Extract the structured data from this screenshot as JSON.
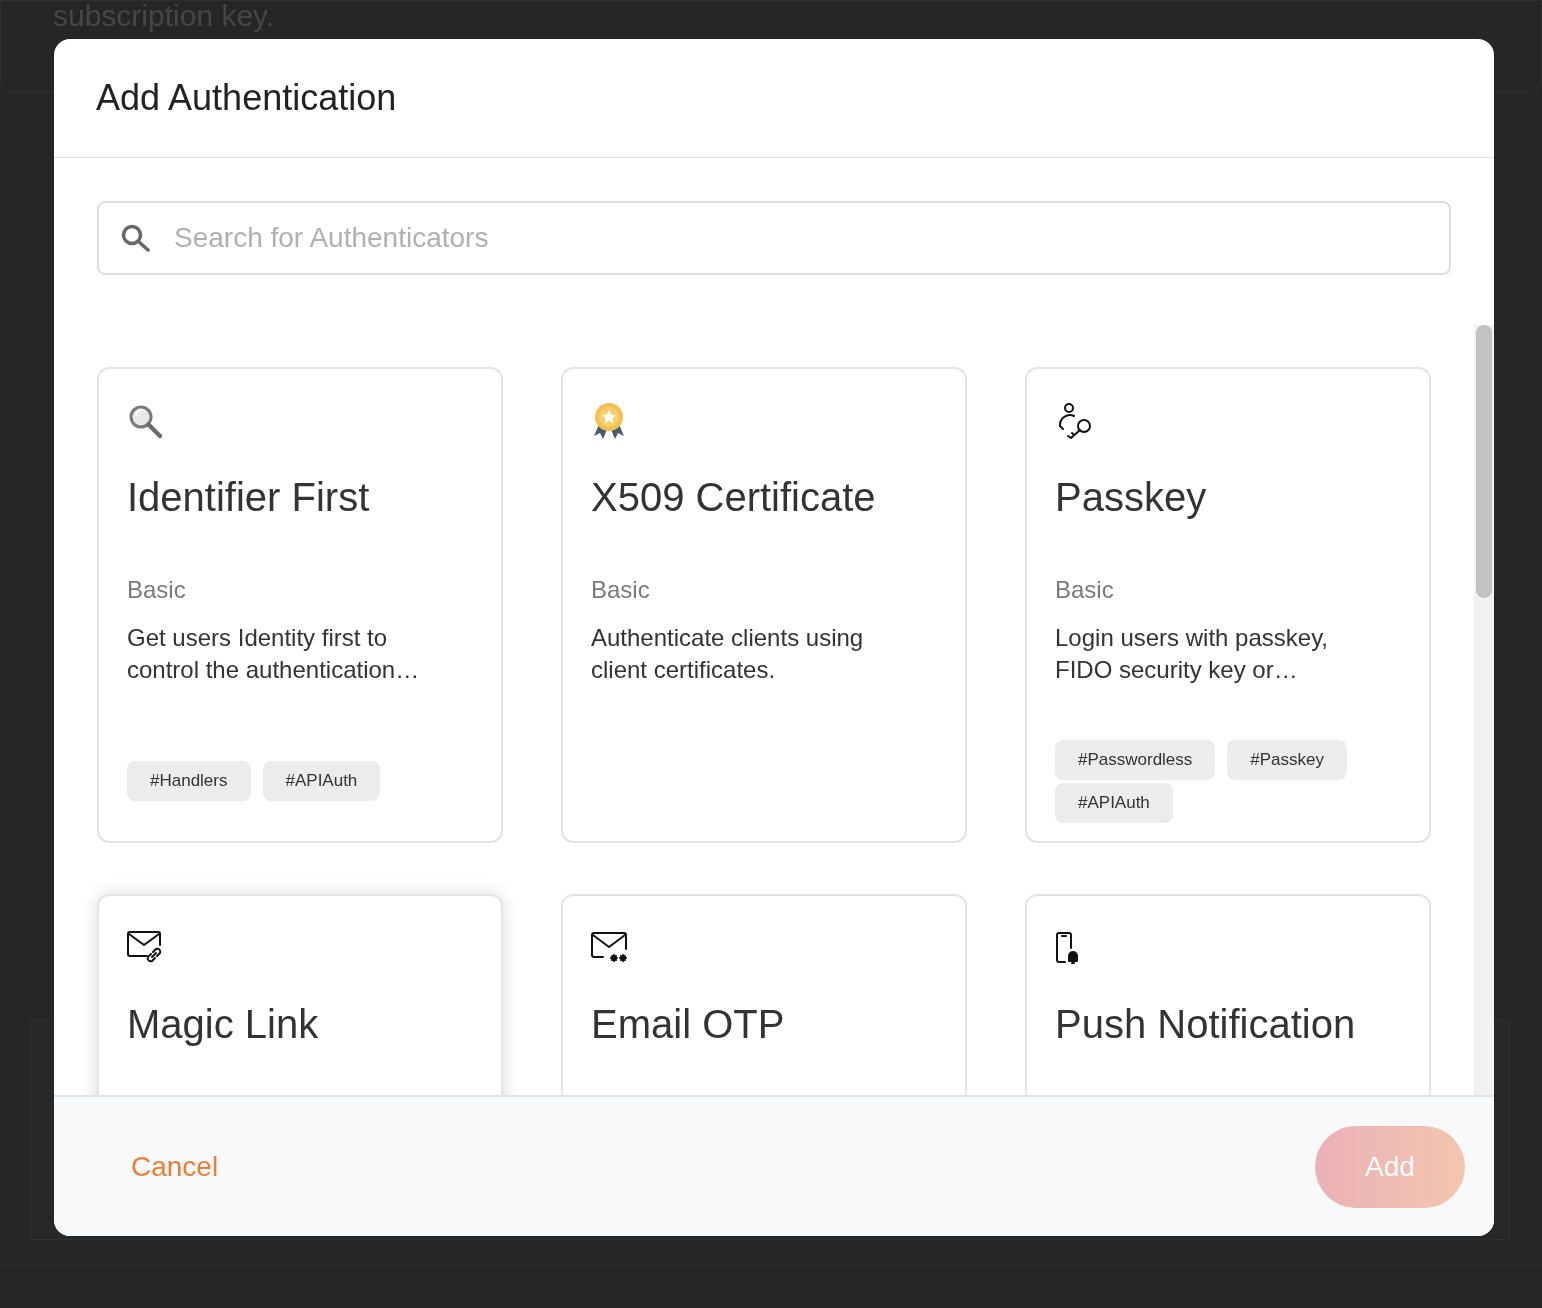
{
  "background": {
    "text": "subscription key."
  },
  "dialog": {
    "title": "Add Authentication",
    "search": {
      "placeholder": "Search for Authenticators"
    },
    "authenticators": [
      {
        "name": "Identifier First",
        "category": "Basic",
        "description": "Get users Identity first to control the authentication…",
        "tags": [
          "#Handlers",
          "#APIAuth"
        ],
        "hovered": false
      },
      {
        "name": "X509 Certificate",
        "category": "Basic",
        "description": "Authenticate clients using client certificates.",
        "hovered": false
      },
      {
        "name": "Passkey",
        "category": "Basic",
        "description": "Login users with passkey, FIDO security key or…",
        "tags": [
          "#Passwordless",
          "#Passkey",
          "#APIAuth"
        ],
        "hovered": false
      },
      {
        "name": "Magic Link",
        "hovered": true
      },
      {
        "name": "Email OTP",
        "hovered": false
      },
      {
        "name": "Push Notification",
        "hovered": false
      }
    ],
    "footer": {
      "cancel": "Cancel",
      "add": {
        "label": "Add",
        "disabled": true
      }
    }
  }
}
